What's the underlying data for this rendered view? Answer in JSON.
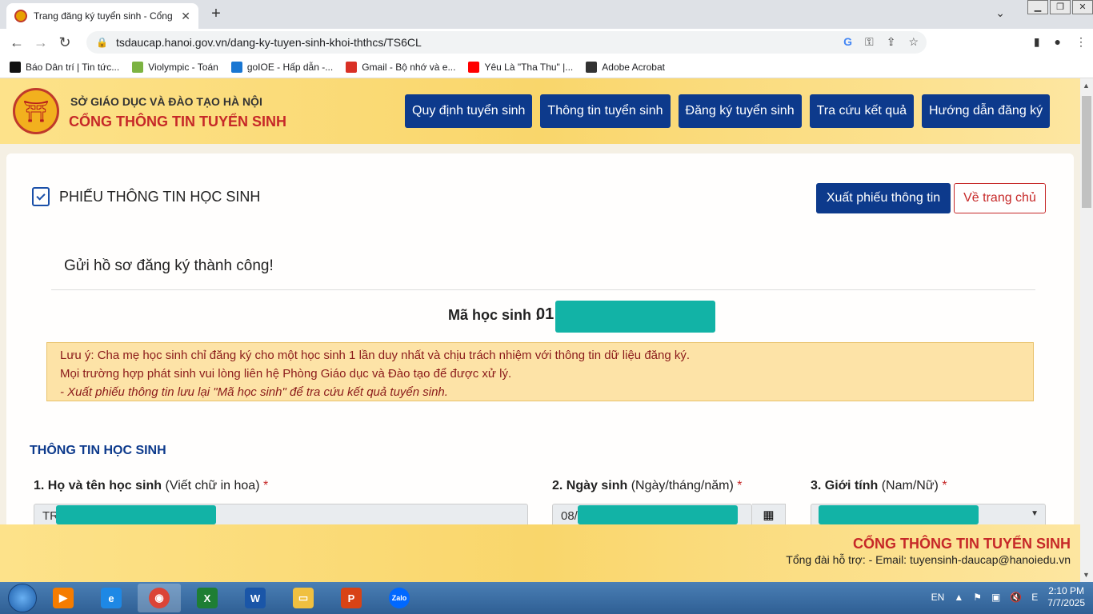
{
  "browser": {
    "tab_title": "Trang đăng ký tuyển sinh - Cổng",
    "new_tab": "+",
    "url": "tsdaucap.hanoi.gov.vn/dang-ky-tuyen-sinh-khoi-ththcs/TS6CL",
    "bookmarks": [
      {
        "label": "Báo Dân trí | Tin tức...",
        "icon": "dantri-icon",
        "color": "#111111"
      },
      {
        "label": "Violympic - Toán",
        "icon": "violympic-icon",
        "color": "#7cb342"
      },
      {
        "label": "goIOE - Hấp dẫn -...",
        "icon": "goioe-icon",
        "color": "#1976d2"
      },
      {
        "label": "Gmail - Bộ nhớ và e...",
        "icon": "gmail-icon",
        "color": "#d93025"
      },
      {
        "label": "Yêu Là \"Tha Thu\" |...",
        "icon": "youtube-icon",
        "color": "#ff0000"
      },
      {
        "label": "Adobe Acrobat",
        "icon": "globe-icon",
        "color": "#333333"
      }
    ]
  },
  "header": {
    "dept": "SỞ GIÁO DỤC VÀ ĐÀO TẠO HÀ NỘI",
    "portal": "CỔNG THÔNG TIN TUYỂN SINH",
    "nav": [
      "Quy định tuyển sinh",
      "Thông tin tuyển sinh",
      "Đăng ký tuyển sinh",
      "Tra cứu kết quả",
      "Hướng dẫn đăng ký"
    ]
  },
  "form": {
    "title": "PHIẾU THÔNG TIN HỌC SINH",
    "export_button": "Xuất phiếu thông tin",
    "home_button": "Về trang chủ",
    "success": "Gửi hồ sơ đăng ký thành công!",
    "student_id_label": "Mã học sinh :",
    "student_id_value": "01",
    "note_line1": "Lưu ý: Cha mẹ học sinh chỉ đăng ký cho một học sinh 1 lần duy nhất và chịu trách nhiệm với thông tin dữ liệu đăng ký.",
    "note_line2": "Mọi trường hợp phát sinh vui lòng liên hệ Phòng Giáo dục và Đào tạo để được xử lý.",
    "note_line3": "- Xuất phiếu thông tin lưu lại \"Mã học sinh\" để tra cứu kết quả tuyển sinh.",
    "section_title": "THÔNG TIN HỌC SINH",
    "field1_label": "1. Họ và tên học sinh",
    "field1_hint": "(Viết chữ in hoa)",
    "field1_value": "TR",
    "field2_label": "2. Ngày sinh",
    "field2_hint": "(Ngày/tháng/năm)",
    "field2_value": "08/",
    "field3_label": "3. Giới tính",
    "field3_hint": "(Nam/Nữ)",
    "required_mark": "*"
  },
  "footer": {
    "title": "CỔNG THÔNG TIN TUYỂN SINH",
    "support": "Tổng đài hỗ trợ: - Email: tuyensinh-daucap@hanoiedu.vn"
  },
  "taskbar": {
    "lang": "EN",
    "time": "2:10 PM",
    "date": "7/7/2025"
  },
  "colors": {
    "primary": "#0d3a8c",
    "accent_red": "#c62828",
    "redaction": "#12b3a6"
  }
}
